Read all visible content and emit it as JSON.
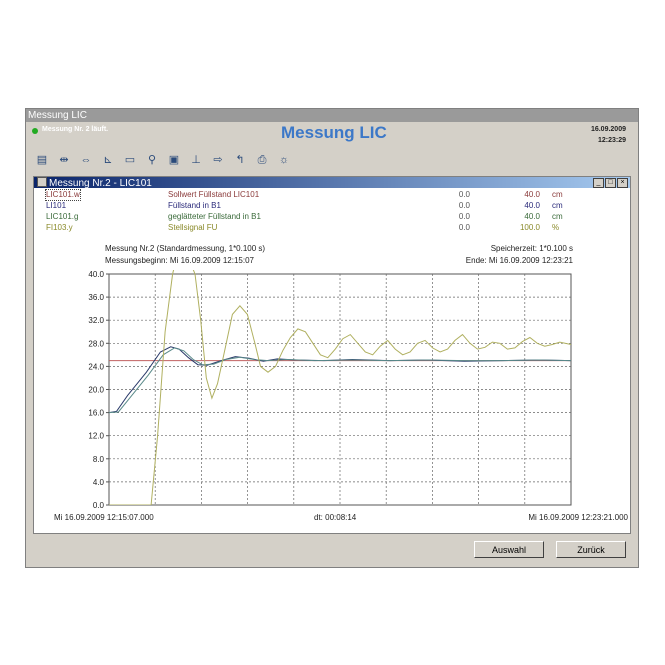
{
  "window": {
    "title": "Messung LIC"
  },
  "header": {
    "status": "Messung Nr. 2 läuft.",
    "title": "Messung LIC",
    "date": "16.09.2009",
    "time": "12:23:29"
  },
  "toolbar": {
    "icons": [
      "grid-icon",
      "zoom-fit-icon",
      "cursor-icon",
      "axis-icon",
      "chart-icon",
      "magnify-icon",
      "save-icon",
      "scale-icon",
      "export-icon",
      "arrow-icon",
      "print-icon",
      "bulb-icon"
    ]
  },
  "child_window": {
    "title": "Messung Nr.2 - LIC101",
    "buttons": [
      "_",
      "□",
      "×"
    ]
  },
  "legend": [
    {
      "id": "LIC101.w",
      "desc": "Sollwert Füllstand LIC101",
      "min": "0.0",
      "max": "40.0",
      "unit": "cm",
      "color": "#a05050"
    },
    {
      "id": "LI101",
      "desc": "Füllstand in B1",
      "min": "0.0",
      "max": "40.0",
      "unit": "cm",
      "color": "#3c3c8c"
    },
    {
      "id": "LIC101.g",
      "desc": "geglätteter Füllstand in B1",
      "min": "0.0",
      "max": "40.0",
      "unit": "cm",
      "color": "#4a7a4a"
    },
    {
      "id": "FI103.y",
      "desc": "Stellsignal FU",
      "min": "0.0",
      "max": "100.0",
      "unit": "%",
      "color": "#a0a040"
    }
  ],
  "info": {
    "left1": "Messung Nr.2 (Standardmessung, 1*0.100 s)",
    "left2": "Messungsbeginn: Mi 16.09.2009 12:15:07",
    "right1": "Speicherzeit:  1*0.100 s",
    "right2": "Ende: Mi 16.09.2009 12:23:21"
  },
  "xaxis": {
    "start": "Mi 16.09.2009 12:15:07.000",
    "mid": "dt: 00:08:14",
    "end": "Mi 16.09.2009 12:23:21.000"
  },
  "chart_data": {
    "type": "line",
    "ylim": [
      0,
      40
    ],
    "yticks": [
      "40.0",
      "36.0",
      "32.0",
      "28.0",
      "24.0",
      "20.0",
      "16.0",
      "12.0",
      "8.0",
      "4.0",
      "0.0"
    ],
    "xlim": [
      0,
      494
    ],
    "series": [
      {
        "name": "LIC101.w",
        "color": "#c06060",
        "points": [
          [
            0,
            25
          ],
          [
            494,
            25
          ]
        ]
      },
      {
        "name": "LI101",
        "color": "#2a3a6a",
        "points": [
          [
            0,
            16
          ],
          [
            8,
            16.2
          ],
          [
            20,
            19
          ],
          [
            40,
            23
          ],
          [
            55,
            26.5
          ],
          [
            66,
            27.4
          ],
          [
            75,
            27
          ],
          [
            85,
            25.5
          ],
          [
            95,
            24.3
          ],
          [
            105,
            24.2
          ],
          [
            120,
            25
          ],
          [
            135,
            25.7
          ],
          [
            150,
            25.4
          ],
          [
            165,
            24.9
          ],
          [
            180,
            25.3
          ],
          [
            200,
            25.1
          ],
          [
            230,
            25
          ],
          [
            260,
            25.2
          ],
          [
            300,
            25
          ],
          [
            340,
            25.1
          ],
          [
            380,
            24.9
          ],
          [
            420,
            25
          ],
          [
            460,
            25.1
          ],
          [
            494,
            25
          ]
        ]
      },
      {
        "name": "LIC101.g",
        "color": "#5a8a8a",
        "points": [
          [
            0,
            16
          ],
          [
            10,
            16.1
          ],
          [
            22,
            18.5
          ],
          [
            42,
            22.5
          ],
          [
            58,
            26
          ],
          [
            70,
            27.2
          ],
          [
            80,
            26.7
          ],
          [
            90,
            25.2
          ],
          [
            100,
            24.3
          ],
          [
            112,
            24.4
          ],
          [
            125,
            25.2
          ],
          [
            140,
            25.6
          ],
          [
            155,
            25.2
          ],
          [
            170,
            25
          ],
          [
            190,
            25.2
          ],
          [
            220,
            25
          ],
          [
            260,
            25.1
          ],
          [
            300,
            25
          ],
          [
            340,
            25.1
          ],
          [
            380,
            25
          ],
          [
            420,
            25
          ],
          [
            460,
            25.1
          ],
          [
            494,
            25
          ]
        ]
      },
      {
        "name": "FI103.y",
        "color": "#b0b060",
        "points": [
          [
            0,
            0
          ],
          [
            45,
            0
          ],
          [
            52,
            12
          ],
          [
            60,
            30
          ],
          [
            68,
            40
          ],
          [
            74,
            44
          ],
          [
            82,
            44
          ],
          [
            92,
            40
          ],
          [
            98,
            32
          ],
          [
            104,
            22
          ],
          [
            110,
            18.5
          ],
          [
            116,
            21
          ],
          [
            124,
            27
          ],
          [
            132,
            33
          ],
          [
            140,
            34.5
          ],
          [
            148,
            33
          ],
          [
            156,
            28
          ],
          [
            162,
            24
          ],
          [
            170,
            23
          ],
          [
            178,
            24
          ],
          [
            186,
            26.8
          ],
          [
            194,
            29
          ],
          [
            202,
            30.5
          ],
          [
            210,
            30
          ],
          [
            218,
            28
          ],
          [
            226,
            26
          ],
          [
            234,
            25.5
          ],
          [
            242,
            27
          ],
          [
            250,
            28.8
          ],
          [
            258,
            29.5
          ],
          [
            266,
            28
          ],
          [
            274,
            26.5
          ],
          [
            282,
            26
          ],
          [
            290,
            27.5
          ],
          [
            298,
            28.5
          ],
          [
            306,
            27
          ],
          [
            314,
            26
          ],
          [
            322,
            26.5
          ],
          [
            330,
            28
          ],
          [
            338,
            28.5
          ],
          [
            346,
            27.2
          ],
          [
            354,
            26.5
          ],
          [
            362,
            27
          ],
          [
            370,
            28.5
          ],
          [
            378,
            29.5
          ],
          [
            386,
            28
          ],
          [
            394,
            27
          ],
          [
            402,
            27.3
          ],
          [
            410,
            28.2
          ],
          [
            418,
            28
          ],
          [
            426,
            27
          ],
          [
            434,
            27.2
          ],
          [
            442,
            28.3
          ],
          [
            450,
            29
          ],
          [
            458,
            28
          ],
          [
            466,
            27.5
          ],
          [
            474,
            27.8
          ],
          [
            482,
            28.2
          ],
          [
            494,
            27.8
          ]
        ]
      }
    ]
  },
  "buttons": {
    "auswahl": "Auswahl",
    "zurueck": "Zurück"
  }
}
